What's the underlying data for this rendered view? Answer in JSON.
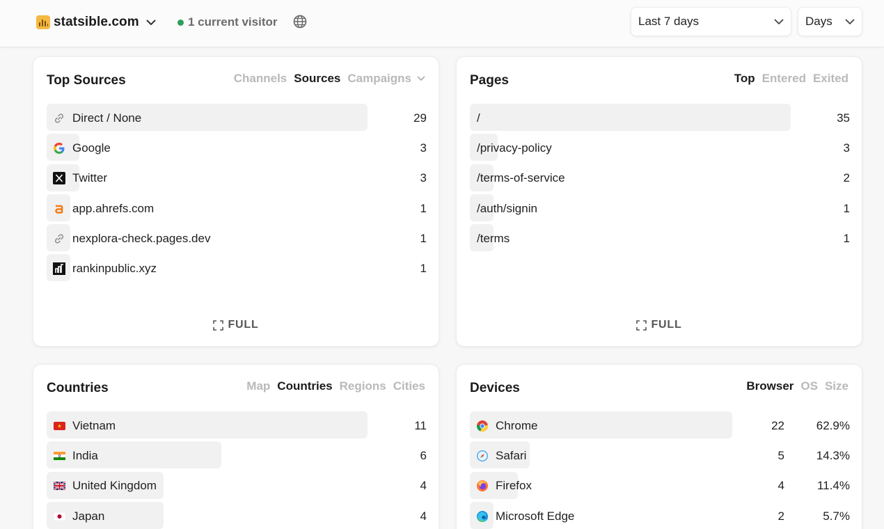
{
  "header": {
    "site_name": "statsible.com",
    "visitors_text": "1 current visitor",
    "date_range": "Last 7 days",
    "interval": "Days"
  },
  "sources": {
    "title": "Top Sources",
    "tabs": [
      "Channels",
      "Sources",
      "Campaigns"
    ],
    "active_tab": "Sources",
    "rows": [
      {
        "label": "Direct / None",
        "value": "29",
        "icon": "link-icon",
        "fraction": 1.0
      },
      {
        "label": "Google",
        "value": "3",
        "icon": "google-icon",
        "fraction": 0.103
      },
      {
        "label": "Twitter",
        "value": "3",
        "icon": "x-twitter-icon",
        "fraction": 0.103
      },
      {
        "label": "app.ahrefs.com",
        "value": "1",
        "icon": "ahrefs-icon",
        "fraction": 0.034
      },
      {
        "label": "nexplora-check.pages.dev",
        "value": "1",
        "icon": "link-icon",
        "fraction": 0.034
      },
      {
        "label": "rankinpublic.xyz",
        "value": "1",
        "icon": "rankinpublic-icon",
        "fraction": 0.034
      }
    ],
    "full_label": "FULL"
  },
  "pages": {
    "title": "Pages",
    "tabs": [
      "Top",
      "Entered",
      "Exited"
    ],
    "active_tab": "Top",
    "rows": [
      {
        "label": "/",
        "value": "35",
        "fraction": 1.0
      },
      {
        "label": "/privacy-policy",
        "value": "3",
        "fraction": 0.086
      },
      {
        "label": "/terms-of-service",
        "value": "2",
        "fraction": 0.057
      },
      {
        "label": "/auth/signin",
        "value": "1",
        "fraction": 0.029
      },
      {
        "label": "/terms",
        "value": "1",
        "fraction": 0.029
      }
    ],
    "full_label": "FULL"
  },
  "countries": {
    "title": "Countries",
    "tabs": [
      "Map",
      "Countries",
      "Regions",
      "Cities"
    ],
    "active_tab": "Countries",
    "rows": [
      {
        "label": "Vietnam",
        "value": "11",
        "icon": "vietnam-flag-icon",
        "fraction": 1.0
      },
      {
        "label": "India",
        "value": "6",
        "icon": "india-flag-icon",
        "fraction": 0.545
      },
      {
        "label": "United Kingdom",
        "value": "4",
        "icon": "uk-flag-icon",
        "fraction": 0.364
      },
      {
        "label": "Japan",
        "value": "4",
        "icon": "japan-flag-icon",
        "fraction": 0.364
      }
    ]
  },
  "devices": {
    "title": "Devices",
    "tabs": [
      "Browser",
      "OS",
      "Size"
    ],
    "active_tab": "Browser",
    "rows": [
      {
        "label": "Chrome",
        "value": "22",
        "percent": "62.9%",
        "icon": "chrome-icon",
        "fraction": 1.0
      },
      {
        "label": "Safari",
        "value": "5",
        "percent": "14.3%",
        "icon": "safari-icon",
        "fraction": 0.227
      },
      {
        "label": "Firefox",
        "value": "4",
        "percent": "11.4%",
        "icon": "firefox-icon",
        "fraction": 0.182
      },
      {
        "label": "Microsoft Edge",
        "value": "2",
        "percent": "5.7%",
        "icon": "edge-icon",
        "fraction": 0.091
      }
    ]
  },
  "colors": {
    "accent_logo": "#f4b942",
    "live_dot": "#2f9e5a",
    "bar_fill": "#f1f1f1",
    "tab_inactive": "#b9b9b9"
  }
}
